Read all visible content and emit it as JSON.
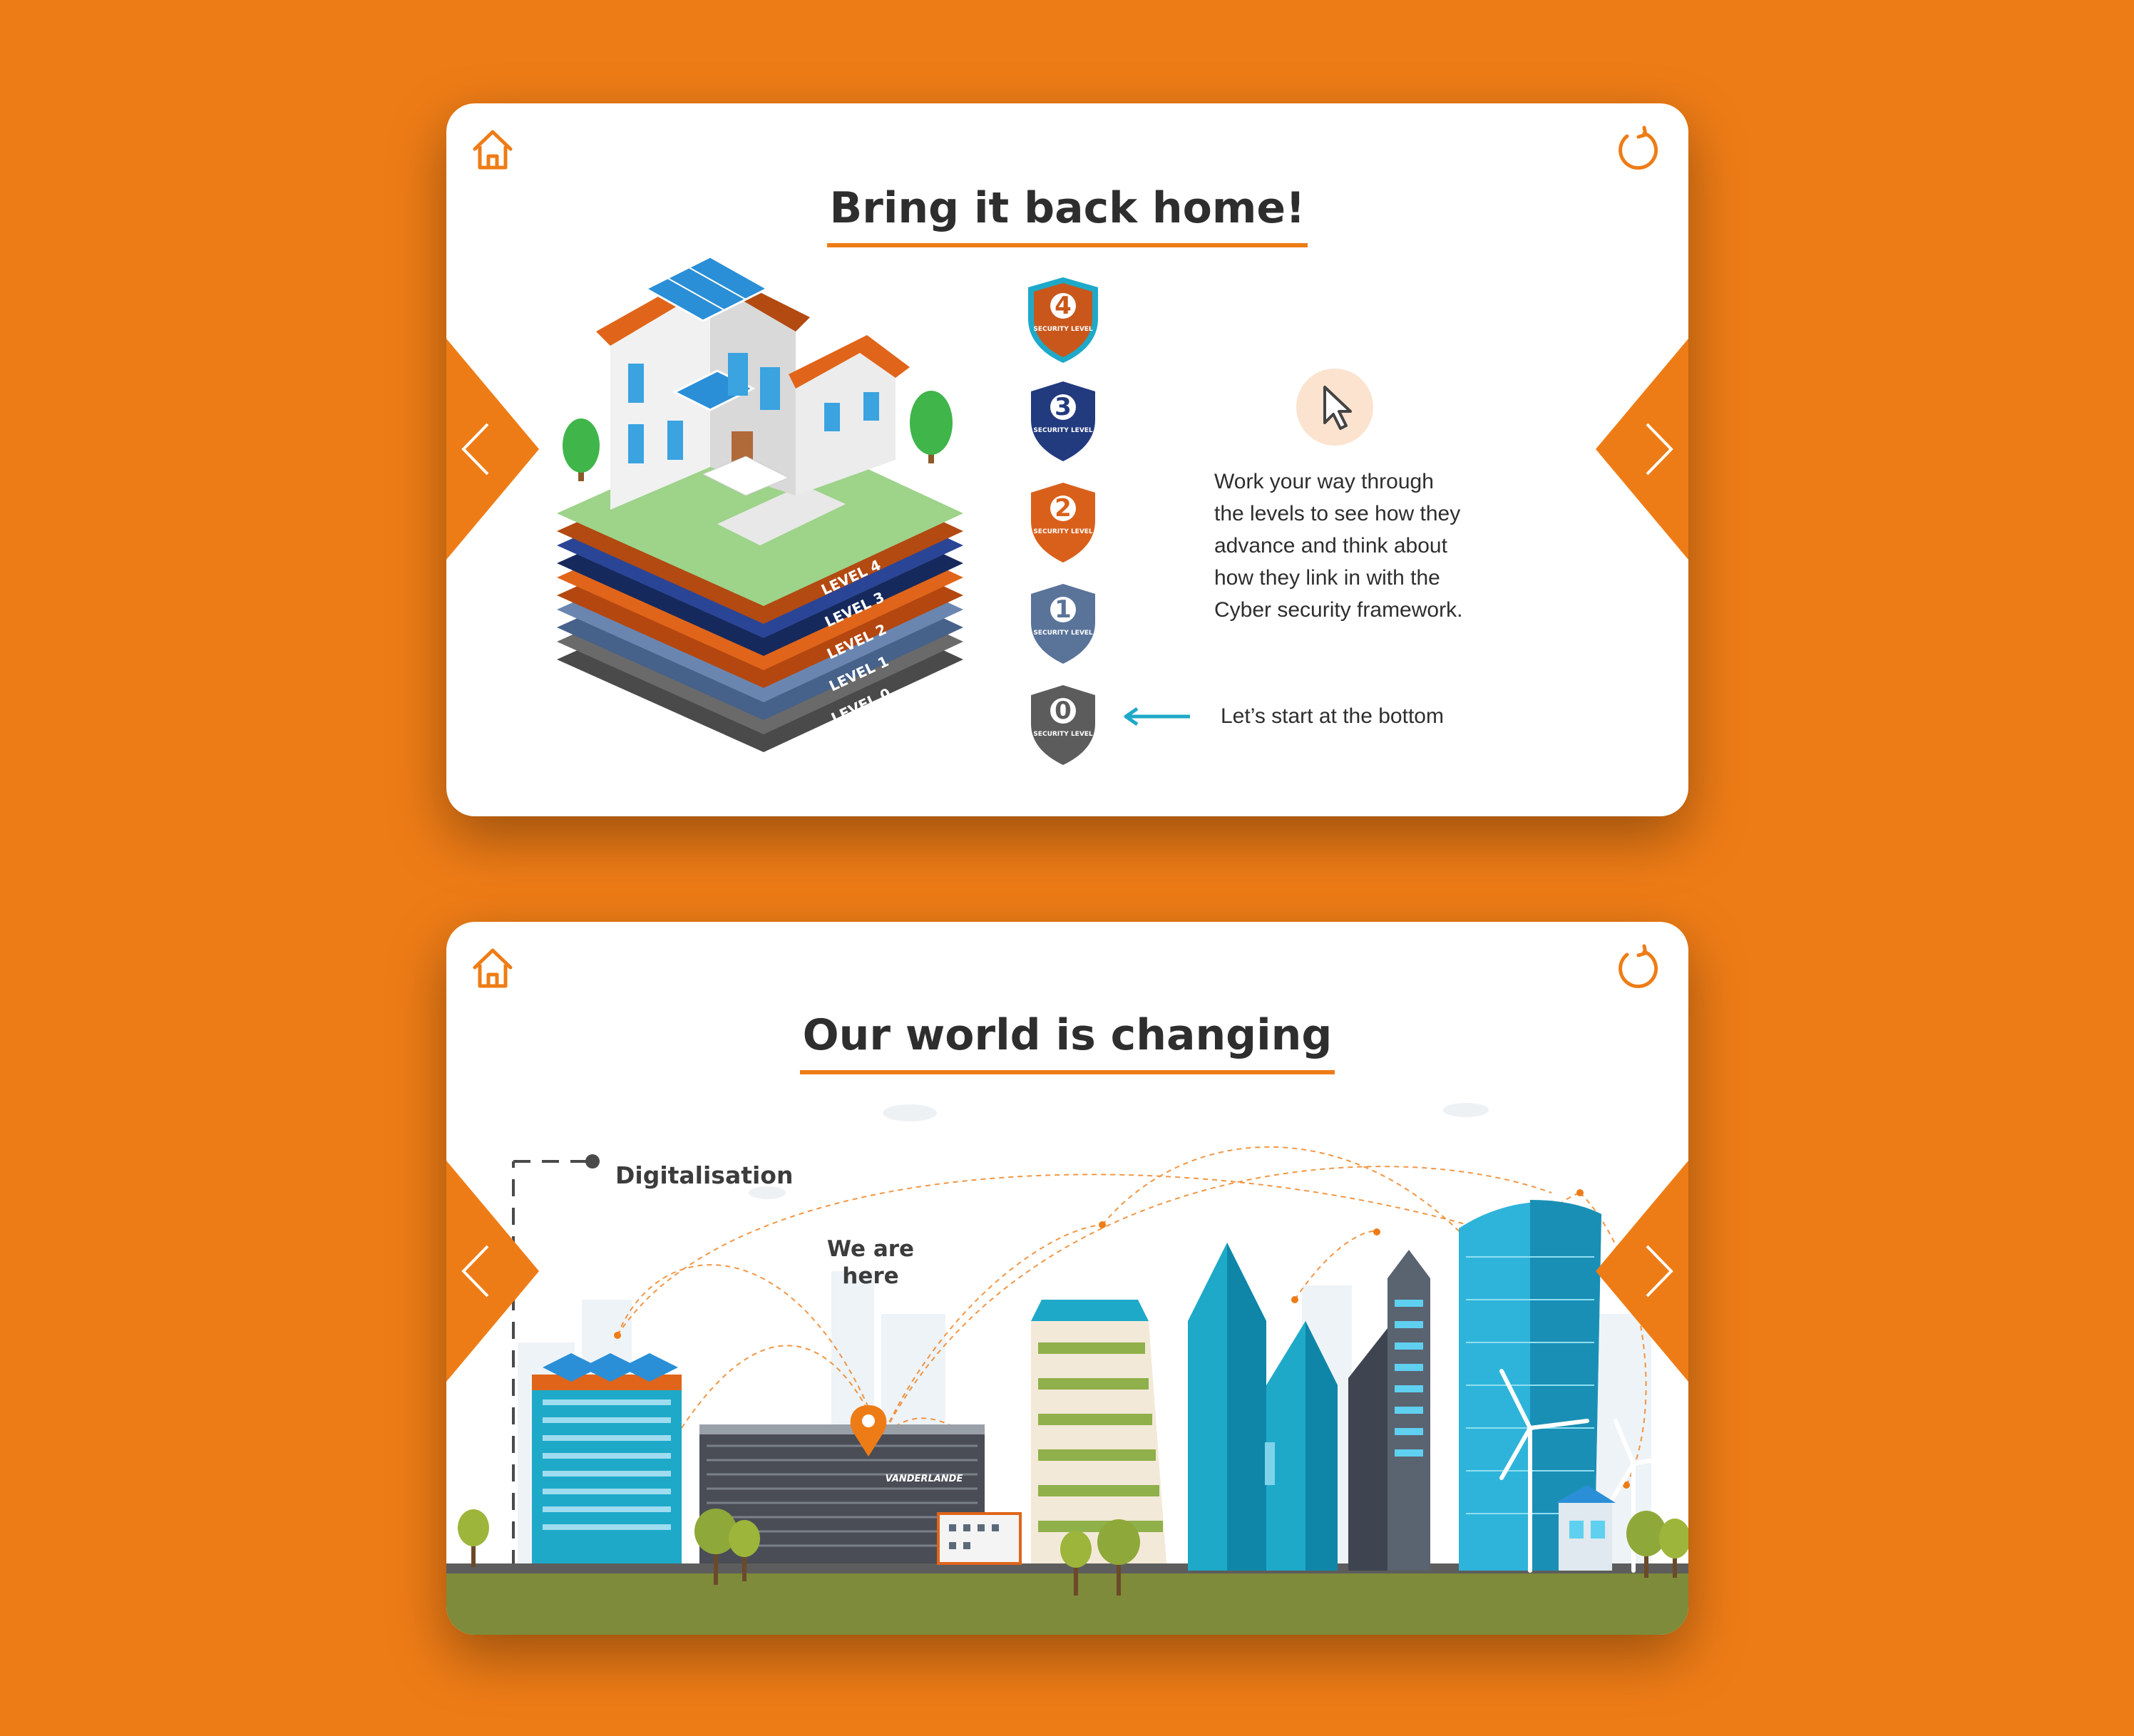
{
  "colors": {
    "background": "#EE7C16",
    "accent": "#EE7C16",
    "teal": "#1EA9C9",
    "navy": "#223A7E",
    "text": "#2e2e2e"
  },
  "slide1": {
    "title": "Bring it back home!",
    "home_icon": "home-icon",
    "refresh_icon": "refresh-icon",
    "house_layers": [
      "LEVEL 4",
      "LEVEL 3",
      "LEVEL 2",
      "LEVEL 1",
      "LEVEL 0"
    ],
    "shields": [
      {
        "number": "4",
        "label": "SECURITY LEVEL",
        "color": "#C9571B"
      },
      {
        "number": "3",
        "label": "SECURITY LEVEL",
        "color": "#223A7E"
      },
      {
        "number": "2",
        "label": "SECURITY LEVEL",
        "color": "#D9601B"
      },
      {
        "number": "1",
        "label": "SECURITY LEVEL",
        "color": "#5A7399"
      },
      {
        "number": "0",
        "label": "SECURITY LEVEL",
        "color": "#5C5C5C"
      }
    ],
    "instruction_lines": [
      "Work your way through",
      "the levels to see how they",
      "advance and think about",
      "how they link in with the",
      "Cyber security framework."
    ],
    "start_hint": "Let’s start at the bottom",
    "cursor_icon": "cursor-icon"
  },
  "slide2": {
    "title": "Our world is changing",
    "home_icon": "home-icon",
    "refresh_icon": "refresh-icon",
    "axis_label": "Digitalisation",
    "marker_label_line1": "We are",
    "marker_label_line2": "here",
    "building_brand": "VANDERLANDE"
  }
}
